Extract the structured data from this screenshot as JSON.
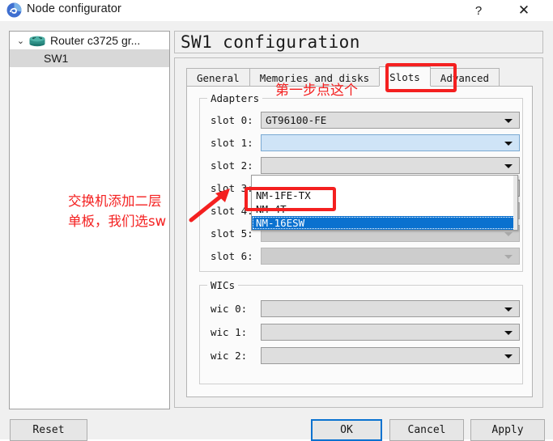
{
  "window": {
    "title": "Node configurator",
    "app_icon": "gns3-icon",
    "help_label": "?",
    "close_label": "✕"
  },
  "tree": {
    "root": {
      "label": "Router c3725 gr...",
      "chevron": "⌄",
      "icon": "router-icon"
    },
    "child": {
      "label": "SW1"
    }
  },
  "config": {
    "title": "SW1 configuration",
    "tabs": [
      {
        "label": "General",
        "active": false
      },
      {
        "label": "Memories and disks",
        "active": false
      },
      {
        "label": "Slots",
        "active": true
      },
      {
        "label": "Advanced",
        "active": false
      }
    ],
    "adapters": {
      "legend": "Adapters",
      "rows": [
        {
          "label": "slot 0:",
          "value": "GT96100-FE",
          "state": "enabled"
        },
        {
          "label": "slot 1:",
          "value": "",
          "state": "open"
        },
        {
          "label": "slot 2:",
          "value": "",
          "state": "enabled"
        },
        {
          "label": "slot 3:",
          "value": "",
          "state": "enabled"
        },
        {
          "label": "slot 4:",
          "value": "",
          "state": "disabled"
        },
        {
          "label": "slot 5:",
          "value": "",
          "state": "disabled"
        },
        {
          "label": "slot 6:",
          "value": "",
          "state": "disabled"
        }
      ]
    },
    "wics": {
      "legend": "WICs",
      "rows": [
        {
          "label": "wic 0:",
          "value": "",
          "state": "enabled"
        },
        {
          "label": "wic 1:",
          "value": "",
          "state": "enabled"
        },
        {
          "label": "wic 2:",
          "value": "",
          "state": "enabled"
        }
      ]
    },
    "dropdown": {
      "open_for": "slot 1:",
      "items": [
        {
          "label": "",
          "selected": false
        },
        {
          "label": "NM-1FE-TX",
          "selected": false
        },
        {
          "label": "NM-4T",
          "selected": false
        },
        {
          "label": "NM-16ESW",
          "selected": true
        }
      ]
    }
  },
  "buttons": {
    "reset": "Reset",
    "ok": "OK",
    "cancel": "Cancel",
    "apply": "Apply"
  },
  "annotations": {
    "step1_text": "第一步点这个",
    "switch_text_line1": "交换机添加二层",
    "switch_text_line2": "单板，我们选sw",
    "color": "#f42020"
  }
}
